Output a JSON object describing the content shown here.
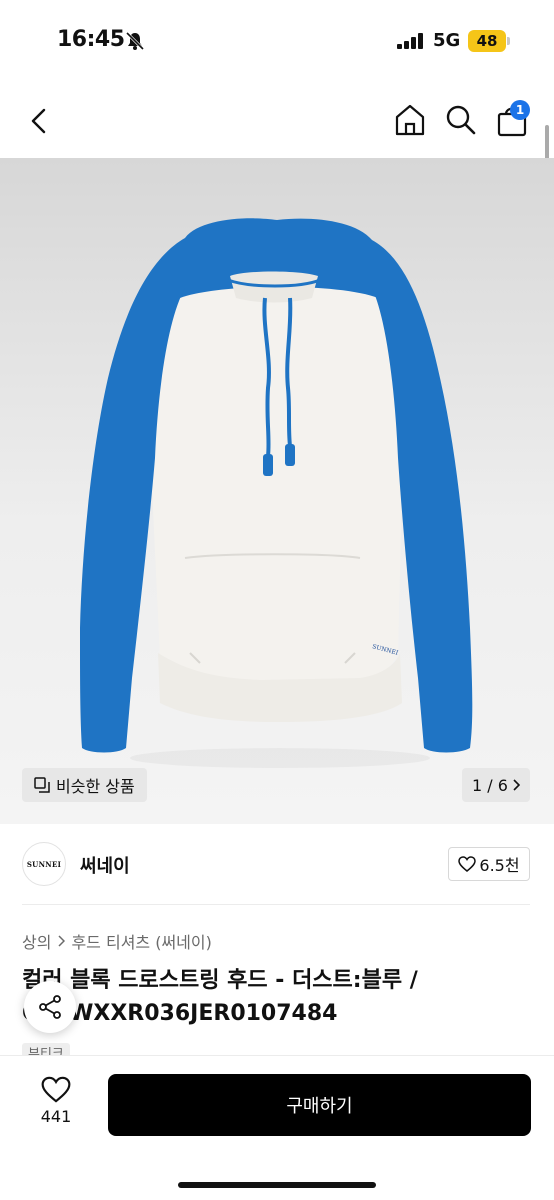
{
  "status_bar": {
    "time": "16:45",
    "network": "5G",
    "battery": "48"
  },
  "nav": {
    "cart_count": "1"
  },
  "image": {
    "similar_label": "비슷한 상품",
    "pager": "1 / 6",
    "print_logo": "SUNNEI"
  },
  "brand": {
    "logo_text": "SUNNEI",
    "name": "써네이",
    "likes": "6.5천"
  },
  "breadcrumb": [
    "상의",
    "후드 티셔츠 (써네이)"
  ],
  "product": {
    "title": "컬러 블록 드로스트링 후드 - 더스트:블루 / CRTWXXR036JER0107484",
    "tag": "부티크"
  },
  "bottom": {
    "wish_count": "441",
    "buy_label": "구매하기"
  },
  "colors": {
    "accent_blue": "#1a73e8",
    "hoodie_blue": "#1f74c4",
    "hoodie_white": "#f4f2ee",
    "buy_button": "#000000",
    "battery": "#f5c518"
  }
}
